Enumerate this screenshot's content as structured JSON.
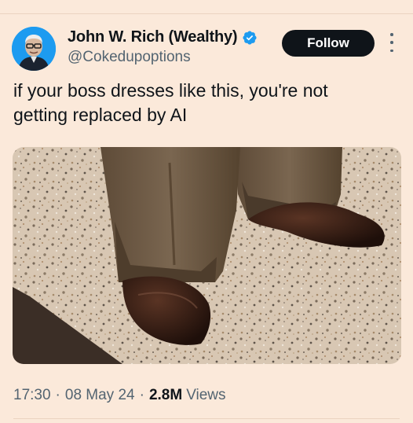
{
  "author": {
    "display_name": "John W. Rich (Wealthy)",
    "handle": "@Cokedupoptions",
    "verified": true,
    "avatar_icon": "person-portrait-icon",
    "verified_icon": "verified-badge-icon"
  },
  "actions": {
    "follow_label": "Follow",
    "more_icon": "more-vertical-icon"
  },
  "tweet": {
    "text_line1": "if your boss dresses like this, you're not",
    "text_line2": "getting replaced by AI",
    "media_icon": "photo-trousers-shoes"
  },
  "meta": {
    "time": "17:30",
    "date": "08 May 24",
    "views_count": "2.8M",
    "views_label": "Views"
  },
  "colors": {
    "background": "#fbe9da",
    "accent": "#1d9bf0",
    "text": "#0f1419",
    "muted": "#536471"
  }
}
